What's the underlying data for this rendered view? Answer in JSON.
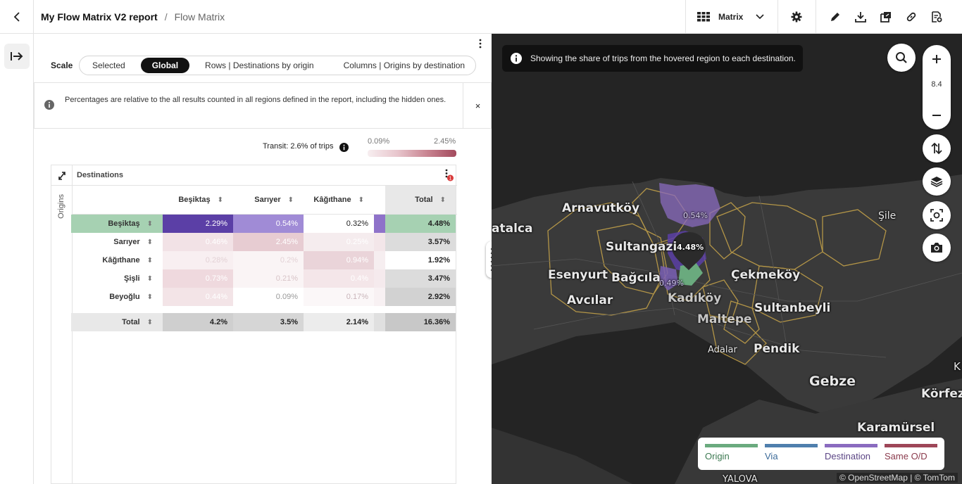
{
  "header": {
    "report_title": "My Flow Matrix V2 report",
    "separator": "/",
    "page_title": "Flow Matrix",
    "view_select": "Matrix"
  },
  "panel": {
    "scale_label": "Scale",
    "scale_options": [
      "Selected",
      "Global",
      "Rows | Destinations by origin",
      "Columns | Origins by destination"
    ],
    "scale_selected": "Global",
    "note": "Percentages are relative to the all results counted in all regions defined in the report, including the hidden ones.",
    "note_close": "×",
    "transit": "Transit: 2.6% of trips",
    "scale_min": "0.09%",
    "scale_max": "2.45%"
  },
  "matrix": {
    "destinations_label": "Destinations",
    "origins_label": "Origins",
    "filter_badge": "1",
    "columns": [
      "Beşiktaş",
      "Sarıyer",
      "Kâğıthane"
    ],
    "total_label": "Total",
    "rows": [
      {
        "label": "Beşiktaş",
        "values": [
          "2.29%",
          "0.54%",
          "0.32%"
        ],
        "total": "4.48%"
      },
      {
        "label": "Sarıyer",
        "values": [
          "0.46%",
          "2.45%",
          "0.25%"
        ],
        "total": "3.57%"
      },
      {
        "label": "Kâğıthane",
        "values": [
          "0.28%",
          "0.2%",
          "0.94%"
        ],
        "total": "1.92%"
      },
      {
        "label": "Şişli",
        "values": [
          "0.73%",
          "0.21%",
          "0.4%"
        ],
        "total": "3.47%"
      },
      {
        "label": "Beyoğlu",
        "values": [
          "0.44%",
          "0.09%",
          "0.17%"
        ],
        "total": "2.92%"
      }
    ],
    "totals_row": {
      "label": "Total",
      "values": [
        "4.2%",
        "3.5%",
        "2.14%"
      ],
      "total": "16.36%"
    }
  },
  "map": {
    "tooltip": "Showing the share of trips from the hovered region to each destination.",
    "zoom_level": "8.4",
    "labels": [
      "Arnavutköy",
      "atalca",
      "Sultangazi",
      "Esenyurt",
      "Bağcıla",
      "Avcılar",
      "Kadıköy",
      "Maltepe",
      "Çekmeköy",
      "Sultanbeyli",
      "Adalar",
      "Pendik",
      "Şile",
      "Gebze",
      "Körfez",
      "Karamürsel",
      "YALOVA",
      "K"
    ],
    "region_values": [
      "0.54%",
      "4.48%",
      "0.49%"
    ],
    "legend": [
      {
        "label": "Origin",
        "color": "#6aaa7e"
      },
      {
        "label": "Via",
        "color": "#4f7fad"
      },
      {
        "label": "Destination",
        "color": "#8a6bbf"
      },
      {
        "label": "Same O/D",
        "color": "#9e4658"
      }
    ],
    "legend_text_colors": {
      "origin": "#3d7a52",
      "via": "#3b6a99",
      "destination": "#5b4585",
      "same": "#8a3a4c"
    },
    "attribution": "© OpenStreetMap | © TomTom"
  }
}
